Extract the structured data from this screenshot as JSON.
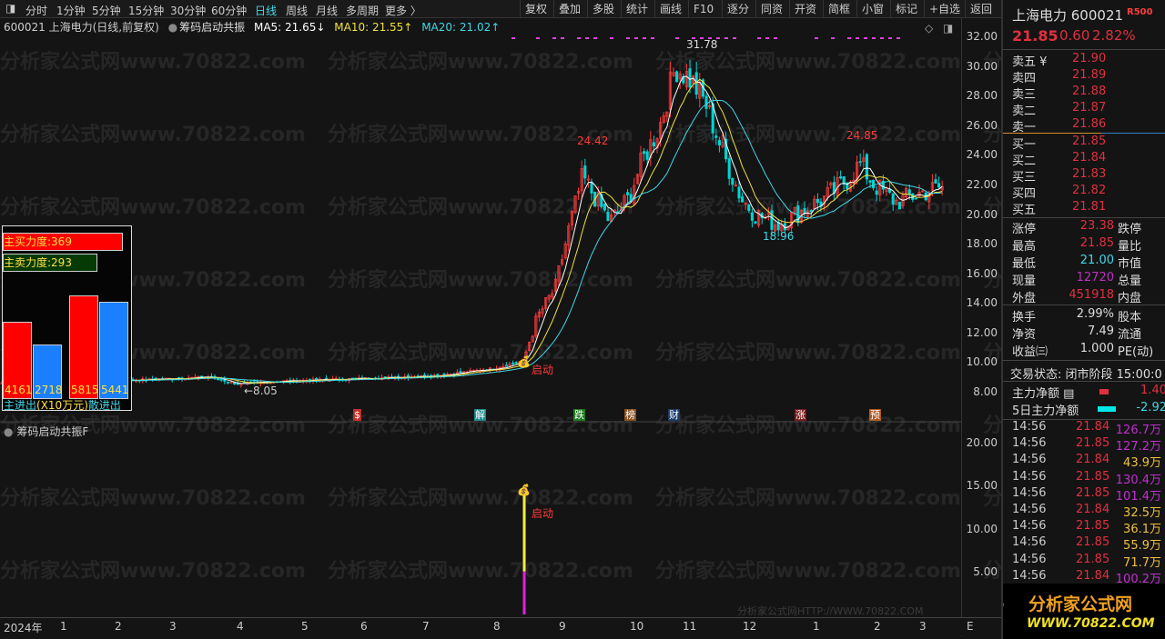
{
  "toolbar": {
    "periods": [
      "分时",
      "1分钟",
      "5分钟",
      "15分钟",
      "30分钟",
      "60分钟",
      "日线",
      "周线",
      "月线",
      "多周期",
      "更多 〉"
    ],
    "active": "日线",
    "buttons": [
      "复权",
      "叠加",
      "多股",
      "统计",
      "画线",
      "F10",
      "逐分",
      "同资",
      "开资",
      "简框",
      "小窗",
      "标记",
      "+自选",
      "返回"
    ]
  },
  "info": {
    "title": "600021 上海电力(日线,前复权)",
    "indicator": "筹码启动共振",
    "ma5": "MA5: 21.65↓",
    "ma10": "MA10: 21.55↑",
    "ma20": "MA20: 21.02↑"
  },
  "colors": {
    "up": "#ff3b3b",
    "down": "#00d4d4",
    "ma5": "#ffffff",
    "ma10": "#f0e040",
    "ma20": "#40d8e8",
    "accent": "#e03040"
  },
  "price_axis": [
    "32.00",
    "30.00",
    "28.00",
    "26.00",
    "24.00",
    "22.00",
    "20.00",
    "18.00",
    "16.00",
    "14.00",
    "12.00",
    "10.00",
    "8.00"
  ],
  "lower_axis": [
    "20.00",
    "15.00",
    "10.00",
    "5.00"
  ],
  "annotations": {
    "high1": "24.42",
    "high2": "31.78",
    "high3": "24.85",
    "low1": "18.96",
    "low0": "←8.05",
    "start": "启动",
    "start2": "启动"
  },
  "key_prices": [
    [
      0,
      8.6
    ],
    [
      60,
      8.7
    ],
    [
      150,
      8.8
    ],
    [
      230,
      9.0
    ],
    [
      262,
      8.5
    ],
    [
      300,
      8.7
    ],
    [
      400,
      8.9
    ],
    [
      480,
      9.1
    ],
    [
      545,
      9.6
    ],
    [
      575,
      10.1
    ],
    [
      590,
      13
    ],
    [
      610,
      15
    ],
    [
      625,
      19
    ],
    [
      640,
      22.5
    ],
    [
      655,
      21
    ],
    [
      670,
      19.5
    ],
    [
      690,
      21
    ],
    [
      705,
      23.5
    ],
    [
      725,
      26
    ],
    [
      742,
      30
    ],
    [
      760,
      29
    ],
    [
      775,
      27.5
    ],
    [
      795,
      24
    ],
    [
      815,
      21
    ],
    [
      830,
      20
    ],
    [
      855,
      19.3
    ],
    [
      880,
      20.2
    ],
    [
      905,
      21
    ],
    [
      930,
      22.3
    ],
    [
      945,
      23.4
    ],
    [
      960,
      22
    ],
    [
      985,
      20.8
    ],
    [
      1010,
      21.4
    ],
    [
      1036,
      21.85
    ]
  ],
  "box": {
    "buy_force": "主买力度:369",
    "sell_force": "主卖力度:293",
    "v1": "4161",
    "v2": "2718",
    "v3": "5815",
    "v4": "5441",
    "footer_a": "主进出",
    "footer_b": "(X10万元)",
    "footer_c": "散进出"
  },
  "events": [
    {
      "t": "$",
      "c": "#c0302a"
    },
    {
      "t": "解",
      "c": "#1a8a8a"
    },
    {
      "t": "跌",
      "c": "#1c7a1c"
    },
    {
      "t": "榜",
      "c": "#8a5020"
    },
    {
      "t": "财",
      "c": "#1a3a6a"
    },
    {
      "t": "涨",
      "c": "#7a1a1a"
    },
    {
      "t": "预",
      "c": "#b05a20"
    }
  ],
  "lower": {
    "title": "筹码启动共振F",
    "signal_value": 15,
    "credit": "分析家公式网HTTP://WWW.70822.COM"
  },
  "dates": [
    "2024年",
    "1",
    "2",
    "3",
    "4",
    "5",
    "6",
    "7",
    "8",
    "9",
    "10",
    "11",
    "12",
    "1",
    "2",
    "3",
    "E"
  ],
  "watermark": "分析家公式网www.70822.com",
  "quote": {
    "name": "上海电力 600021",
    "badge": "R500",
    "price": "21.85",
    "change": "0.60",
    "pct": "2.82%",
    "asks": [
      [
        "卖五 ¥",
        "21.90"
      ],
      [
        "卖四",
        "21.89"
      ],
      [
        "卖三",
        "21.88"
      ],
      [
        "卖二",
        "21.87"
      ],
      [
        "卖一",
        "21.86"
      ]
    ],
    "bids": [
      [
        "买一",
        "21.85"
      ],
      [
        "买二",
        "21.84"
      ],
      [
        "买三",
        "21.83"
      ],
      [
        "买四",
        "21.82"
      ],
      [
        "买五",
        "21.81"
      ]
    ],
    "stats": [
      [
        "涨停",
        "23.38",
        "跌停"
      ],
      [
        "最高",
        "21.85",
        "量比"
      ],
      [
        "最低",
        "21.00",
        "市值"
      ],
      [
        "现量",
        "12720",
        "总量"
      ],
      [
        "外盘",
        "451918",
        "内盘"
      ]
    ],
    "stats2": [
      [
        "换手",
        "2.99%",
        "股本"
      ],
      [
        "净资",
        "7.49",
        "流通"
      ],
      [
        "收益㈢",
        "1.000",
        "PE(动)"
      ]
    ],
    "status": "交易状态: 闭市阶段 15:00:0",
    "flow": [
      [
        "主力净额 ▤",
        "1.40"
      ],
      [
        "5日主力净额",
        "-2.92"
      ]
    ],
    "ticks": [
      [
        "14:56",
        "21.84",
        "126.7万"
      ],
      [
        "14:56",
        "21.85",
        "127.2万"
      ],
      [
        "14:56",
        "21.84",
        "43.9万"
      ],
      [
        "14:56",
        "21.85",
        "130.4万"
      ],
      [
        "14:56",
        "21.85",
        "101.4万"
      ],
      [
        "14:56",
        "21.84",
        "32.5万"
      ],
      [
        "14:56",
        "21.85",
        "36.1万"
      ],
      [
        "14:56",
        "21.85",
        "55.9万"
      ],
      [
        "14:56",
        "21.85",
        "71.7万"
      ],
      [
        "14:56",
        "21.84",
        "100.2万"
      ]
    ]
  },
  "logo": {
    "cn": "分析家公式网",
    "url": "WWW.70822.COM"
  }
}
